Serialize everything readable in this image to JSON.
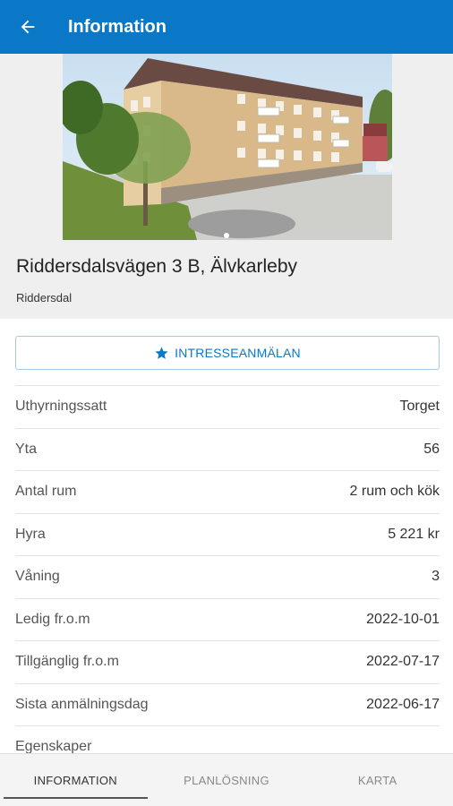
{
  "appbar": {
    "title": "Information",
    "back_icon": "arrow-left-icon"
  },
  "listing": {
    "address": "Riddersdalsvägen 3 B, Älvkarleby",
    "area": "Riddersdal"
  },
  "interest_button": {
    "label": "INTRESSEANMÄLAN",
    "icon": "star-icon"
  },
  "details": [
    {
      "key": "Uthyrningssatt",
      "value": "Torget"
    },
    {
      "key": "Yta",
      "value": "56"
    },
    {
      "key": "Antal rum",
      "value": "2 rum och kök"
    },
    {
      "key": "Hyra",
      "value": "5 221 kr"
    },
    {
      "key": "Våning",
      "value": "3"
    },
    {
      "key": "Ledig fr.o.m",
      "value": "2022-10-01"
    },
    {
      "key": "Tillgänglig fr.o.m",
      "value": "2022-07-17"
    },
    {
      "key": "Sista anmälningsdag",
      "value": "2022-06-17"
    },
    {
      "key": "Egenskaper",
      "value": ""
    }
  ],
  "tabs": [
    "INFORMATION",
    "PLANLÖSNING",
    "KARTA"
  ],
  "colors": {
    "primary": "#0a78c6",
    "background_light": "#efefef"
  }
}
